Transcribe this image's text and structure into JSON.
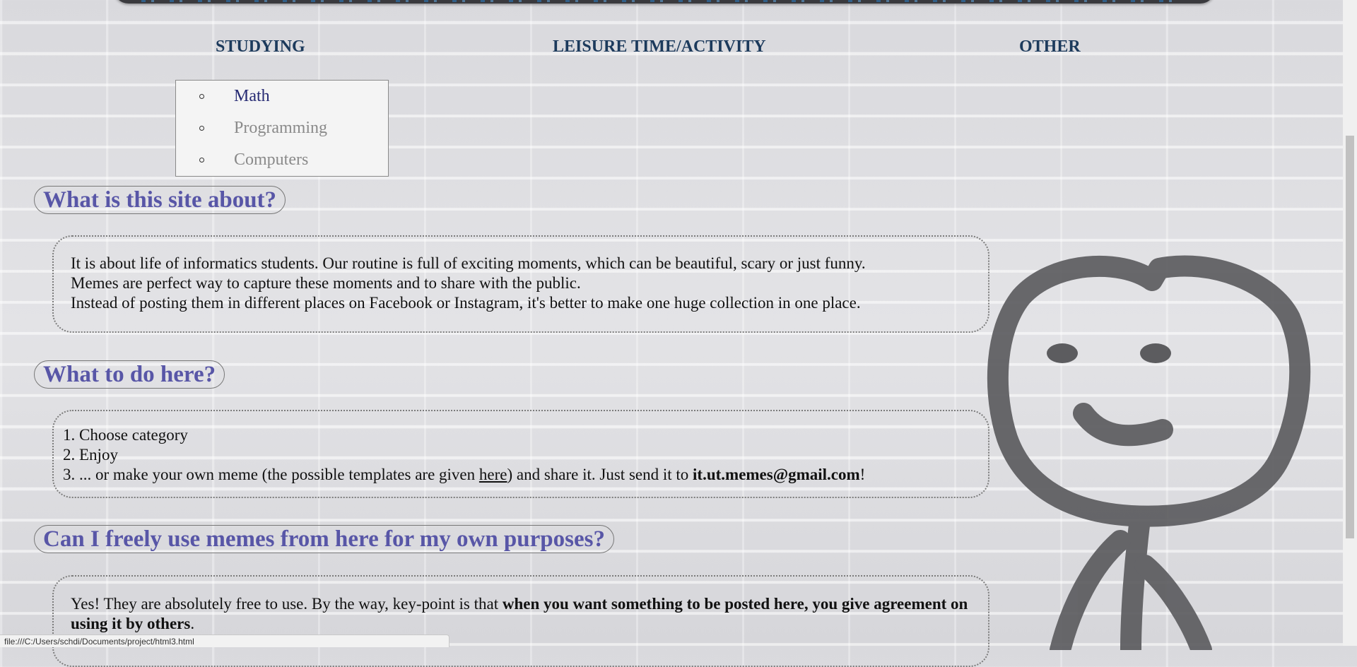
{
  "nav": {
    "items": [
      {
        "label": "STUDYING"
      },
      {
        "label": "LEISURE TIME/ACTIVITY"
      },
      {
        "label": "OTHER"
      }
    ]
  },
  "dropdown": {
    "items": [
      {
        "label": "Math",
        "active": true
      },
      {
        "label": "Programming",
        "active": false
      },
      {
        "label": "Computers",
        "active": false
      }
    ]
  },
  "sections": {
    "about": {
      "heading": "What is this site about?",
      "lines": [
        "It is about life of informatics students. Our routine is full of exciting moments, which can be beautiful, scary or just funny.",
        "Memes are perfect way to capture these moments and to share with the public.",
        "Instead of posting them in different places on Facebook or Instagram, it's better to make one huge collection in one place."
      ]
    },
    "todo": {
      "heading": "What to do here?",
      "step1": "1. Choose category",
      "step2": "2. Enjoy",
      "step3_before": "3. ... or make your own meme (the possible templates are given ",
      "step3_link": "here",
      "step3_middle": ") and share it. Just send it to ",
      "step3_email": "it.ut.memes@gmail.com",
      "step3_after": "!"
    },
    "usage": {
      "heading": "Can I freely use memes from here for my own purposes?",
      "text_before": "Yes! They are absolutely free to use. By the way, key-point is that ",
      "text_bold": "when you want something to be posted here, you give agreement on using it by others",
      "text_after": "."
    }
  },
  "status_bar": {
    "url": "file:///C:/Users/schdi/Documents/project/html3.html"
  },
  "colors": {
    "heading": "#5856a7",
    "nav": "#1c3a5c",
    "active_item": "#262a73",
    "inactive_item": "#8a8a8a"
  }
}
